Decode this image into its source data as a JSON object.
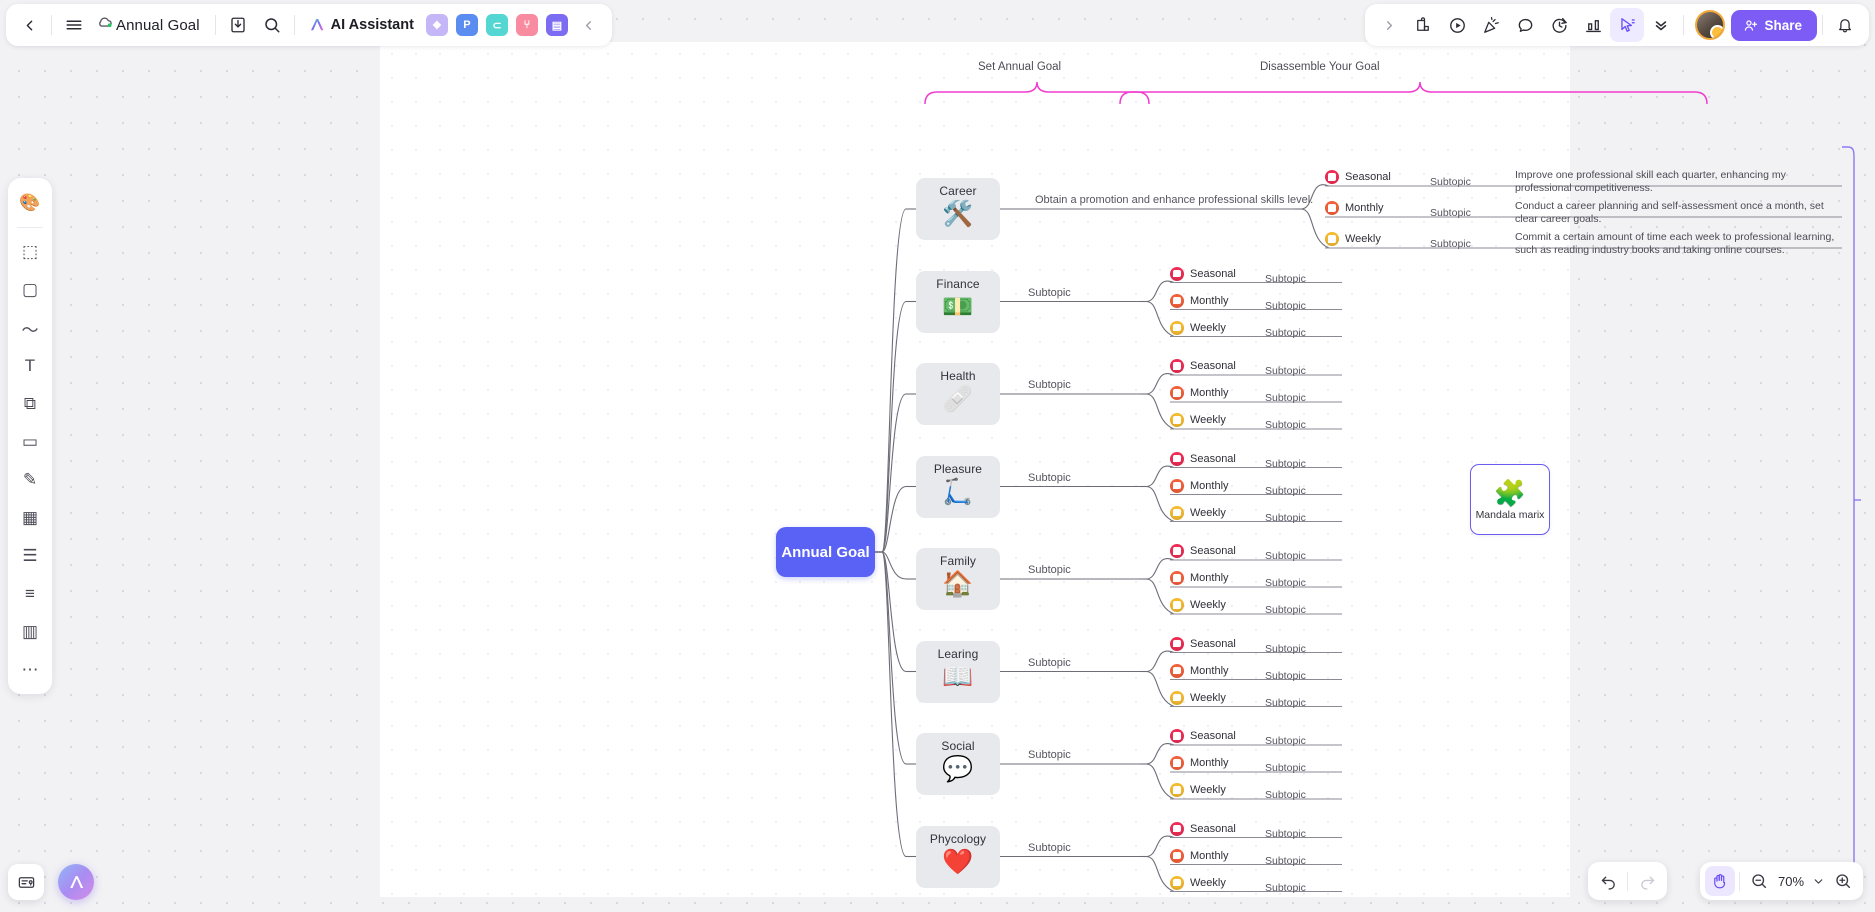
{
  "app": {
    "title": "Annual Goal",
    "zoom_level": "70%"
  },
  "toolbar_left": {
    "back_icon": "chevron-left-icon",
    "menu_icon": "hamburger-menu-icon",
    "cloud_icon": "cloud-saved-icon",
    "title": "Annual Goal",
    "download_icon": "download-icon",
    "search_icon": "search-icon",
    "ai_assistant_label": "AI Assistant",
    "apps": [
      {
        "name": "image-app",
        "glyph": "❖",
        "color": "#c5b6f7"
      },
      {
        "name": "presentation-app",
        "glyph": "P",
        "color": "#5b8cf0"
      },
      {
        "name": "concept-map-app",
        "glyph": "⊂",
        "color": "#54d6d2"
      },
      {
        "name": "org-chart-app",
        "glyph": "⑂",
        "color": "#f98ba0"
      },
      {
        "name": "board-app",
        "glyph": "▤",
        "color": "#7b6cf2"
      }
    ],
    "collapse_icon": "chevron-left-icon"
  },
  "toolbar_right": {
    "expand_icon": "chevron-right-icon",
    "items": [
      {
        "name": "sticky-lock-icon"
      },
      {
        "name": "play-circle-icon"
      },
      {
        "name": "celebrate-icon"
      },
      {
        "name": "comment-icon"
      },
      {
        "name": "timer-icon"
      },
      {
        "name": "chart-icon"
      },
      {
        "name": "cursor-select-icon",
        "active": true
      },
      {
        "name": "chevrons-down-icon"
      }
    ],
    "avatar": "user-avatar",
    "share_label": "Share",
    "share_icon": "add-person-icon",
    "bell_icon": "notification-bell-icon"
  },
  "tool_rail": {
    "items": [
      {
        "name": "theme-palette-tool",
        "glyph": "🎨"
      },
      {
        "name": "frame-tool",
        "glyph": "⬚"
      },
      {
        "name": "shape-tool",
        "glyph": "▢"
      },
      {
        "name": "curve-line-tool",
        "glyph": "〜"
      },
      {
        "name": "text-tool",
        "glyph": "T"
      },
      {
        "name": "connector-tool",
        "glyph": "⧉"
      },
      {
        "name": "sticky-note-tool",
        "glyph": "▭"
      },
      {
        "name": "pen-draw-tool",
        "glyph": "✎"
      },
      {
        "name": "table-tool",
        "glyph": "▦"
      },
      {
        "name": "document-tool",
        "glyph": "☰"
      },
      {
        "name": "outline-tool",
        "glyph": "≡"
      },
      {
        "name": "layout-columns-tool",
        "glyph": "▥"
      },
      {
        "name": "more-tools",
        "glyph": "⋯"
      }
    ]
  },
  "bottom_left": {
    "card_icon": "card-badge-icon",
    "ai_orb_label": "AI"
  },
  "bottom_right": {
    "undo_label": "undo-icon",
    "redo_label": "redo-icon",
    "hand_tool": "hand-pan-icon",
    "zoom_out": "zoom-out-icon",
    "zoom_value": "70%",
    "zoom_dropdown": "chevron-down-icon",
    "zoom_in": "zoom-in-icon"
  },
  "mindmap": {
    "root": "Annual Goal",
    "group_headers": [
      {
        "label": "Set Annual Goal"
      },
      {
        "label": "Disassemble Your Goal"
      }
    ],
    "frequency_labels": {
      "seasonal": "Seasonal",
      "monthly": "Monthly",
      "weekly": "Weekly"
    },
    "subtopic_placeholder": "Subtopic",
    "branches": [
      {
        "name": "Career",
        "emoji": "🛠️",
        "goal": "Obtain a promotion and enhance professional skills level.",
        "rows": [
          {
            "freq": "Seasonal",
            "color": "#ef2d56",
            "subtopic": "Subtopic",
            "detail": "Improve one professional skill each quarter, enhancing my professional competitiveness."
          },
          {
            "freq": "Monthly",
            "color": "#f4603a",
            "subtopic": "Subtopic",
            "detail": "Conduct a career planning and self-assessment once a month, set clear career goals."
          },
          {
            "freq": "Weekly",
            "color": "#f6bb2e",
            "subtopic": "Subtopic",
            "detail": "Commit a certain amount of time each week to professional learning, such as reading industry books and taking online courses."
          }
        ]
      },
      {
        "name": "Finance",
        "emoji": "💵",
        "goal": "Subtopic",
        "rows": [
          {
            "freq": "Seasonal",
            "color": "#ef2d56",
            "subtopic": "Subtopic",
            "detail": ""
          },
          {
            "freq": "Monthly",
            "color": "#f4603a",
            "subtopic": "Subtopic",
            "detail": ""
          },
          {
            "freq": "Weekly",
            "color": "#f6bb2e",
            "subtopic": "Subtopic",
            "detail": ""
          }
        ]
      },
      {
        "name": "Health",
        "emoji": "🩹",
        "goal": "Subtopic",
        "rows": [
          {
            "freq": "Seasonal",
            "color": "#ef2d56",
            "subtopic": "Subtopic",
            "detail": ""
          },
          {
            "freq": "Monthly",
            "color": "#f4603a",
            "subtopic": "Subtopic",
            "detail": ""
          },
          {
            "freq": "Weekly",
            "color": "#f6bb2e",
            "subtopic": "Subtopic",
            "detail": ""
          }
        ]
      },
      {
        "name": "Pleasure",
        "emoji": "🛴",
        "goal": "Subtopic",
        "rows": [
          {
            "freq": "Seasonal",
            "color": "#ef2d56",
            "subtopic": "Subtopic",
            "detail": ""
          },
          {
            "freq": "Monthly",
            "color": "#f4603a",
            "subtopic": "Subtopic",
            "detail": ""
          },
          {
            "freq": "Weekly",
            "color": "#f6bb2e",
            "subtopic": "Subtopic",
            "detail": ""
          }
        ]
      },
      {
        "name": "Family",
        "emoji": "🏠",
        "goal": "Subtopic",
        "rows": [
          {
            "freq": "Seasonal",
            "color": "#ef2d56",
            "subtopic": "Subtopic",
            "detail": ""
          },
          {
            "freq": "Monthly",
            "color": "#f4603a",
            "subtopic": "Subtopic",
            "detail": ""
          },
          {
            "freq": "Weekly",
            "color": "#f6bb2e",
            "subtopic": "Subtopic",
            "detail": ""
          }
        ]
      },
      {
        "name": "Learing",
        "emoji": "📖",
        "goal": "Subtopic",
        "rows": [
          {
            "freq": "Seasonal",
            "color": "#ef2d56",
            "subtopic": "Subtopic",
            "detail": ""
          },
          {
            "freq": "Monthly",
            "color": "#f4603a",
            "subtopic": "Subtopic",
            "detail": ""
          },
          {
            "freq": "Weekly",
            "color": "#f6bb2e",
            "subtopic": "Subtopic",
            "detail": ""
          }
        ]
      },
      {
        "name": "Social",
        "emoji": "💬",
        "goal": "Subtopic",
        "rows": [
          {
            "freq": "Seasonal",
            "color": "#ef2d56",
            "subtopic": "Subtopic",
            "detail": ""
          },
          {
            "freq": "Monthly",
            "color": "#f4603a",
            "subtopic": "Subtopic",
            "detail": ""
          },
          {
            "freq": "Weekly",
            "color": "#f6bb2e",
            "subtopic": "Subtopic",
            "detail": ""
          }
        ]
      },
      {
        "name": "Phycology",
        "emoji": "❤️",
        "goal": "Subtopic",
        "rows": [
          {
            "freq": "Seasonal",
            "color": "#ef2d56",
            "subtopic": "Subtopic",
            "detail": ""
          },
          {
            "freq": "Monthly",
            "color": "#f4603a",
            "subtopic": "Subtopic",
            "detail": ""
          },
          {
            "freq": "Weekly",
            "color": "#f6bb2e",
            "subtopic": "Subtopic",
            "detail": ""
          }
        ]
      }
    ],
    "floating_card": {
      "label": "Mandala marix",
      "emoji": "🧩"
    }
  }
}
